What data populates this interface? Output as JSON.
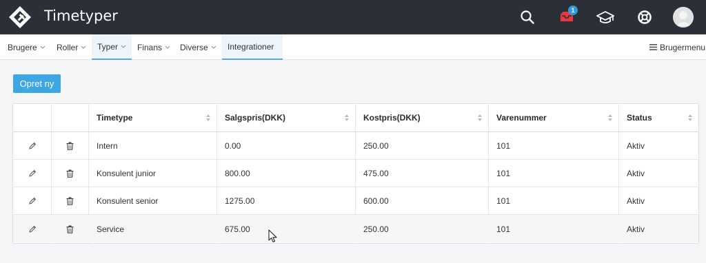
{
  "app": {
    "title": "Timetyper",
    "notification_count": "1"
  },
  "top_icons": [
    "search-icon",
    "inbox-icon",
    "graduation-cap-icon",
    "lifebuoy-icon"
  ],
  "nav": {
    "items": [
      {
        "label": "Brugere",
        "chevron": true,
        "active": false
      },
      {
        "label": "Roller",
        "chevron": true,
        "active": false
      },
      {
        "label": "Typer",
        "chevron": true,
        "active": true
      },
      {
        "label": "Finans",
        "chevron": true,
        "active": false
      },
      {
        "label": "Diverse",
        "chevron": true,
        "active": false
      },
      {
        "label": "Integrationer",
        "chevron": false,
        "active": true
      }
    ],
    "user_menu": "Brugermenu"
  },
  "create_button": "Opret ny",
  "table": {
    "columns": [
      "Timetype",
      "Salgspris(DKK)",
      "Kostpris(DKK)",
      "Varenummer",
      "Status"
    ],
    "rows": [
      [
        "Intern",
        "0.00",
        "250.00",
        "101",
        "Aktiv"
      ],
      [
        "Konsulent junior",
        "800.00",
        "475.00",
        "101",
        "Aktiv"
      ],
      [
        "Konsulent senior",
        "1275.00",
        "600.00",
        "101",
        "Aktiv"
      ],
      [
        "Service",
        "675.00",
        "250.00",
        "101",
        "Aktiv"
      ]
    ]
  },
  "colors": {
    "topbar": "#2b3038",
    "accent": "#3fa6e4",
    "inbox_red": "#e8393f"
  }
}
